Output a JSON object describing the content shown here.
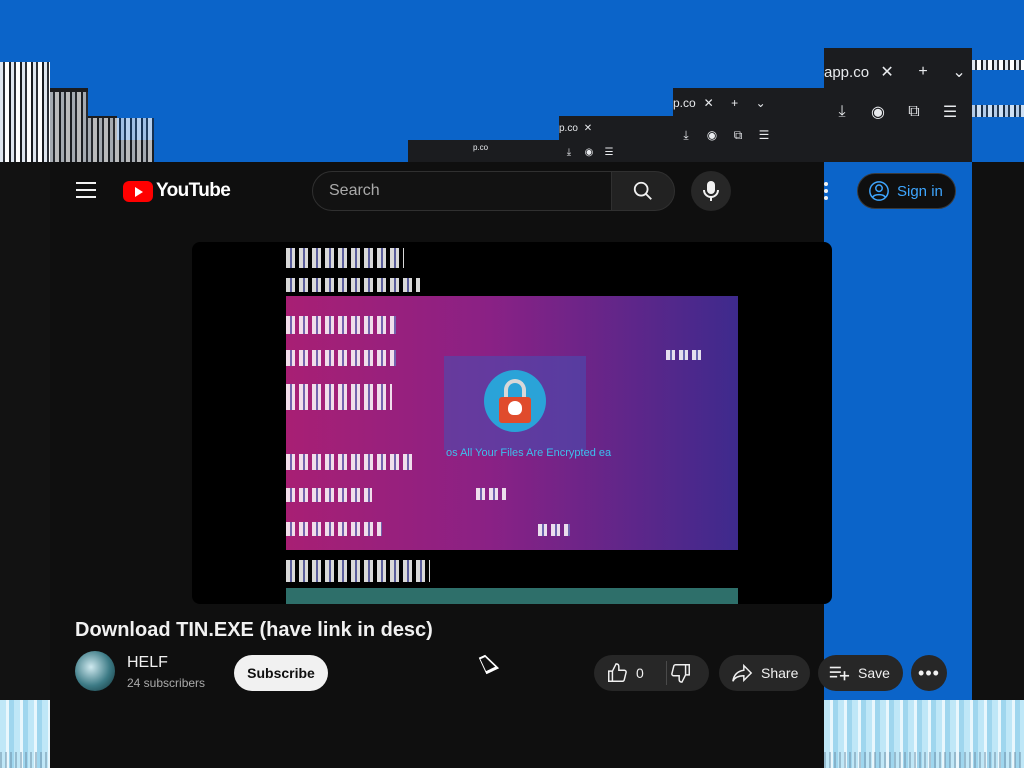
{
  "browser": {
    "tab_fragment_main": "app.co",
    "tab_fragment_mid": "p.co",
    "tab_fragment_small": "p.co",
    "tab_fragment_tiny": "p.co"
  },
  "masthead": {
    "logo_text": "YouTube",
    "search_placeholder": "Search",
    "signin_label": "Sign in"
  },
  "player": {
    "screen_caption": "os All Your Files Are Encrypted  ea"
  },
  "video": {
    "title": "Download TIN.EXE (have link in desc)",
    "channel_name": "HELF",
    "subscriber_count": "24 subscribers",
    "subscribe_label": "Subscribe",
    "like_count": "0",
    "share_label": "Share",
    "save_label": "Save"
  },
  "colors": {
    "accent": "#3ea6ff",
    "brand": "#ff0000",
    "page_bg": "#0f0f0f",
    "desktop_blue": "#0b64c9"
  }
}
